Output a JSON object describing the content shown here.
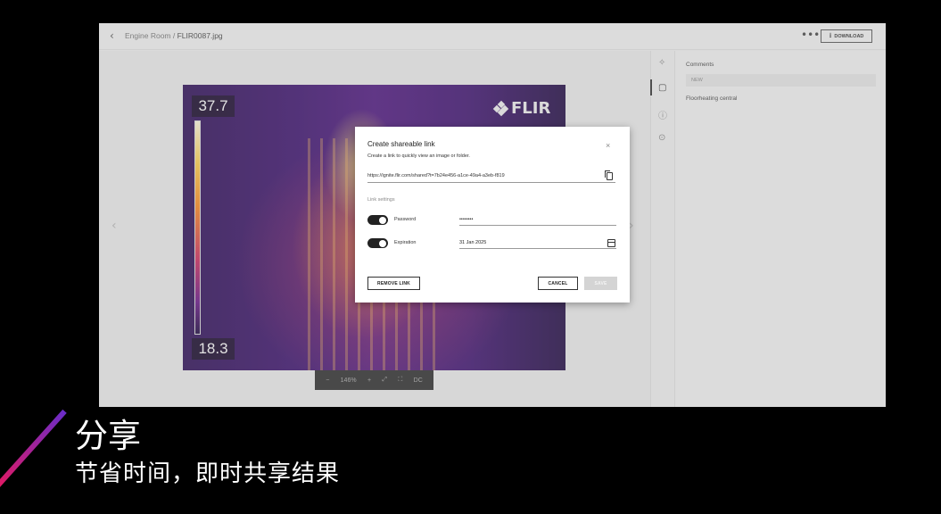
{
  "header": {
    "breadcrumb_parent": "Engine Room",
    "breadcrumb_separator": " / ",
    "breadcrumb_file": "FLIR0087.jpg",
    "more_label": "•••",
    "download_label": "DOWNLOAD"
  },
  "image": {
    "temp_max": "37.7",
    "temp_min": "18.3",
    "logo_text": "FLIR"
  },
  "zoombar": {
    "zoom_out": "−",
    "zoom_level": "146%",
    "zoom_in": "+",
    "dc_label": "DC"
  },
  "comments": {
    "title": "Comments",
    "input_placeholder": "NEW",
    "items": [
      {
        "text": "Floorheating central"
      }
    ]
  },
  "modal": {
    "title": "Create shareable link",
    "close": "×",
    "description": "Create a link to quickly view an image or folder.",
    "link_url": "https://ignite.flir.com/shared?t=7b24e456-a1ce-49a4-a3eb-f819",
    "settings_label": "Link settings",
    "password_label": "Password",
    "password_value": "••••••••",
    "expiration_label": "Expiration",
    "expiration_value": "31 Jan 2025",
    "remove_label": "REMOVE LINK",
    "cancel_label": "CANCEL",
    "save_label": "SAVE"
  },
  "caption": {
    "title": "分享",
    "subtitle": "节省时间，即时共享结果"
  },
  "colors": {
    "accent_gradient_start": "#e8185d",
    "accent_gradient_end": "#6a2cc8",
    "toggle_on": "#222222"
  }
}
